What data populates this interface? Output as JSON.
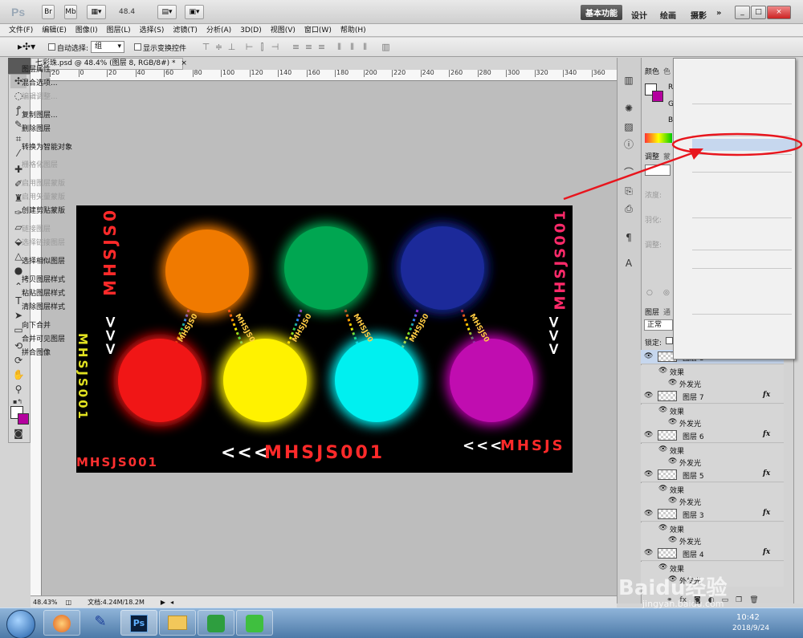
{
  "app": {
    "logo": "Ps",
    "app_icons": [
      "Br",
      "Mb"
    ],
    "zoom": "48.4",
    "workspaces": [
      "基本功能",
      "设计",
      "绘画",
      "摄影",
      "»"
    ],
    "window_controls": [
      "_",
      "□",
      "×"
    ]
  },
  "menu": [
    "文件(F)",
    "编辑(E)",
    "图像(I)",
    "图层(L)",
    "选择(S)",
    "滤镜(T)",
    "分析(A)",
    "3D(D)",
    "视图(V)",
    "窗口(W)",
    "帮助(H)"
  ],
  "options": {
    "auto_select_label": "自动选择:",
    "auto_select_value": "组",
    "transform_label": "显示变换控件"
  },
  "document": {
    "tab_title": "七彩珠.psd @ 48.4% (图层 8, RGB/8#) *",
    "tab_close": "×",
    "ruler_ticks": [
      "20",
      "0",
      "20",
      "40",
      "60",
      "80",
      "100",
      "120",
      "140",
      "160",
      "180",
      "200",
      "220",
      "240",
      "260",
      "280",
      "300",
      "320",
      "340",
      "360"
    ],
    "status_zoom": "48.43%",
    "status_doc": "文档:4.24M/18.2M",
    "canvas_texts": {
      "left_vertical": "MHSJS0",
      "left_arrows": "<<<",
      "right_vertical": "MHSJS001",
      "right_arrows": "<<<",
      "left_edge_vertical": "MHSJS001",
      "bottom_left": "MHSJS001",
      "bottom_center_arrows": "<<<",
      "bottom_center": "MHSJS001",
      "bottom_right_arrows": "<<<",
      "bottom_right": "MHSJS",
      "chain_text": "MHSJS0"
    }
  },
  "panels": {
    "tabs_top": [
      "颜色",
      "色"
    ],
    "rgb": [
      "R",
      "G",
      "B"
    ],
    "adjust_tabs": [
      "调整",
      "蒙"
    ],
    "layers_tabs": [
      "图层",
      "通"
    ],
    "blend_mode": "正常",
    "lock_label": "锁定:",
    "faded_labels": [
      "浓度:",
      "羽化:",
      "调整:"
    ]
  },
  "layers": [
    {
      "name": "图层 8",
      "has_fx": false
    },
    {
      "name": "图层 7",
      "has_fx": true
    },
    {
      "name": "图层 6",
      "has_fx": true
    },
    {
      "name": "图层 5",
      "has_fx": true
    },
    {
      "name": "图层 3",
      "has_fx": true
    },
    {
      "name": "图层 4",
      "has_fx": true
    }
  ],
  "layer_effects": {
    "effects": "效果",
    "outer_glow": "外发光",
    "fx": "fx"
  },
  "context_menu": [
    {
      "label": "图层属性...",
      "enabled": true
    },
    {
      "label": "混合选项...",
      "enabled": true
    },
    {
      "label": "编辑调整...",
      "enabled": false
    },
    {
      "label": "复制图层...",
      "enabled": true
    },
    {
      "label": "删除图层",
      "enabled": true
    },
    {
      "label": "转换为智能对象",
      "enabled": true,
      "highlighted": true
    },
    {
      "label": "栅格化图层",
      "enabled": false
    },
    {
      "label": "启用图层蒙版",
      "enabled": false
    },
    {
      "label": "启用矢量蒙版",
      "enabled": false
    },
    {
      "label": "创建剪贴蒙版",
      "enabled": true
    },
    {
      "label": "链接图层",
      "enabled": false
    },
    {
      "label": "选择链接图层",
      "enabled": false
    },
    {
      "label": "选择相似图层",
      "enabled": true
    },
    {
      "label": "拷贝图层样式",
      "enabled": true
    },
    {
      "label": "粘贴图层样式",
      "enabled": true
    },
    {
      "label": "清除图层样式",
      "enabled": true
    },
    {
      "label": "向下合并",
      "enabled": true
    },
    {
      "label": "合并可见图层",
      "enabled": true
    },
    {
      "label": "拼合图像",
      "enabled": true
    }
  ],
  "taskbar": {
    "time": "10:42",
    "date": "2018/9/24",
    "ps_button": "Ps"
  },
  "watermark": {
    "brand": "Baidu经验",
    "url": "jingyan.baidu.com"
  },
  "colors": {
    "annotation_red": "#e8151d",
    "orb_orange": "#f07a00",
    "orb_green": "#00a651",
    "orb_navy": "#1a2a9a",
    "orb_red": "#f01818",
    "orb_yellow": "#fff200",
    "orb_cyan": "#00f0f0",
    "orb_magenta": "#c010b0",
    "menu_highlight": "#c6d7ee"
  }
}
